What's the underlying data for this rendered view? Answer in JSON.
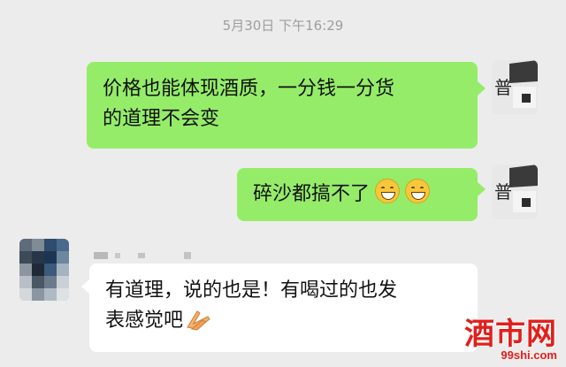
{
  "timestamp": "5月30日 下午16:29",
  "messages": [
    {
      "direction": "out",
      "line1": "价格也能体现酒质，一分钱一分货",
      "line2": "的道理不会变"
    },
    {
      "direction": "out",
      "text": "碎沙都搞不了"
    },
    {
      "direction": "in",
      "sender_name": "",
      "line1": "有道理，说的也是！有喝过的也发",
      "line2": "表感觉吧"
    }
  ],
  "watermark": {
    "text": "酒市网",
    "url": "99shi.com"
  },
  "icons": [
    "grin-emoji-icon",
    "grin-emoji-icon",
    "praying-hands-icon"
  ],
  "colors": {
    "background": "#ececec",
    "out_bubble": "#95ec69",
    "in_bubble": "#ffffff",
    "watermark_red": "#e0201c"
  }
}
